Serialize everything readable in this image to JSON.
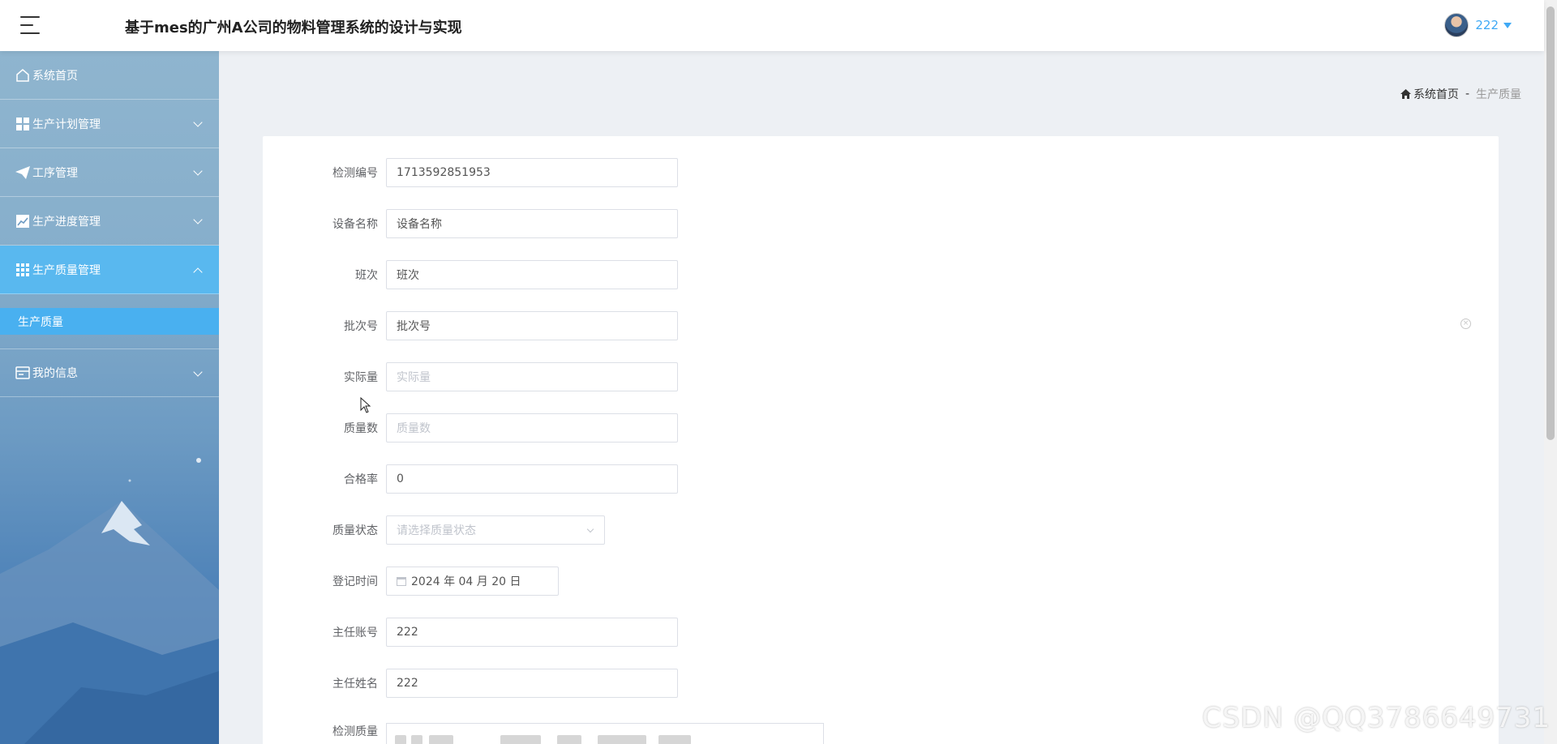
{
  "header": {
    "title": "基于mes的广州A公司的物料管理系统的设计与实现",
    "user_name": "222",
    "menu_icon": "hamburger-icon",
    "avatar_icon": "avatar"
  },
  "sidebar": {
    "items": [
      {
        "label": "系统首页",
        "icon": "home-icon"
      },
      {
        "label": "生产计划管理",
        "icon": "grid-icon"
      },
      {
        "label": "工序管理",
        "icon": "paper-plane-icon"
      },
      {
        "label": "生产进度管理",
        "icon": "line-chart-icon"
      },
      {
        "label": "生产质量管理",
        "icon": "table-icon",
        "active": true
      },
      {
        "label": "我的信息",
        "icon": "card-icon"
      }
    ],
    "sub_items": [
      "生产质量"
    ]
  },
  "breadcrumb": {
    "home": "系统首页",
    "separator": "-",
    "current": "生产质量"
  },
  "form": {
    "fields": [
      {
        "label": "检测编号",
        "value": "1713592851953",
        "placeholder": ""
      },
      {
        "label": "设备名称",
        "value": "设备名称",
        "placeholder": ""
      },
      {
        "label": "班次",
        "value": "班次",
        "placeholder": ""
      },
      {
        "label": "批次号",
        "value": "批次号",
        "placeholder": ""
      },
      {
        "label": "实际量",
        "value": "",
        "placeholder": "实际量"
      },
      {
        "label": "质量数",
        "value": "",
        "placeholder": "质量数"
      },
      {
        "label": "合格率",
        "value": "0",
        "placeholder": ""
      },
      {
        "label": "质量状态",
        "value": "",
        "placeholder": "请选择质量状态"
      },
      {
        "label": "登记时间",
        "value": "2024 年 04 月 20 日",
        "placeholder": ""
      },
      {
        "label": "主任账号",
        "value": "222",
        "placeholder": ""
      },
      {
        "label": "主任姓名",
        "value": "222",
        "placeholder": ""
      },
      {
        "label": "检测质量",
        "value": "",
        "placeholder": ""
      }
    ]
  },
  "watermark": "CSDN @QQ3786649731",
  "colors": {
    "accent": "#3fa9f5",
    "active_menu": "#59b8ef",
    "sub_menu": "#49b0f0",
    "page_bg": "#edf0f4"
  }
}
